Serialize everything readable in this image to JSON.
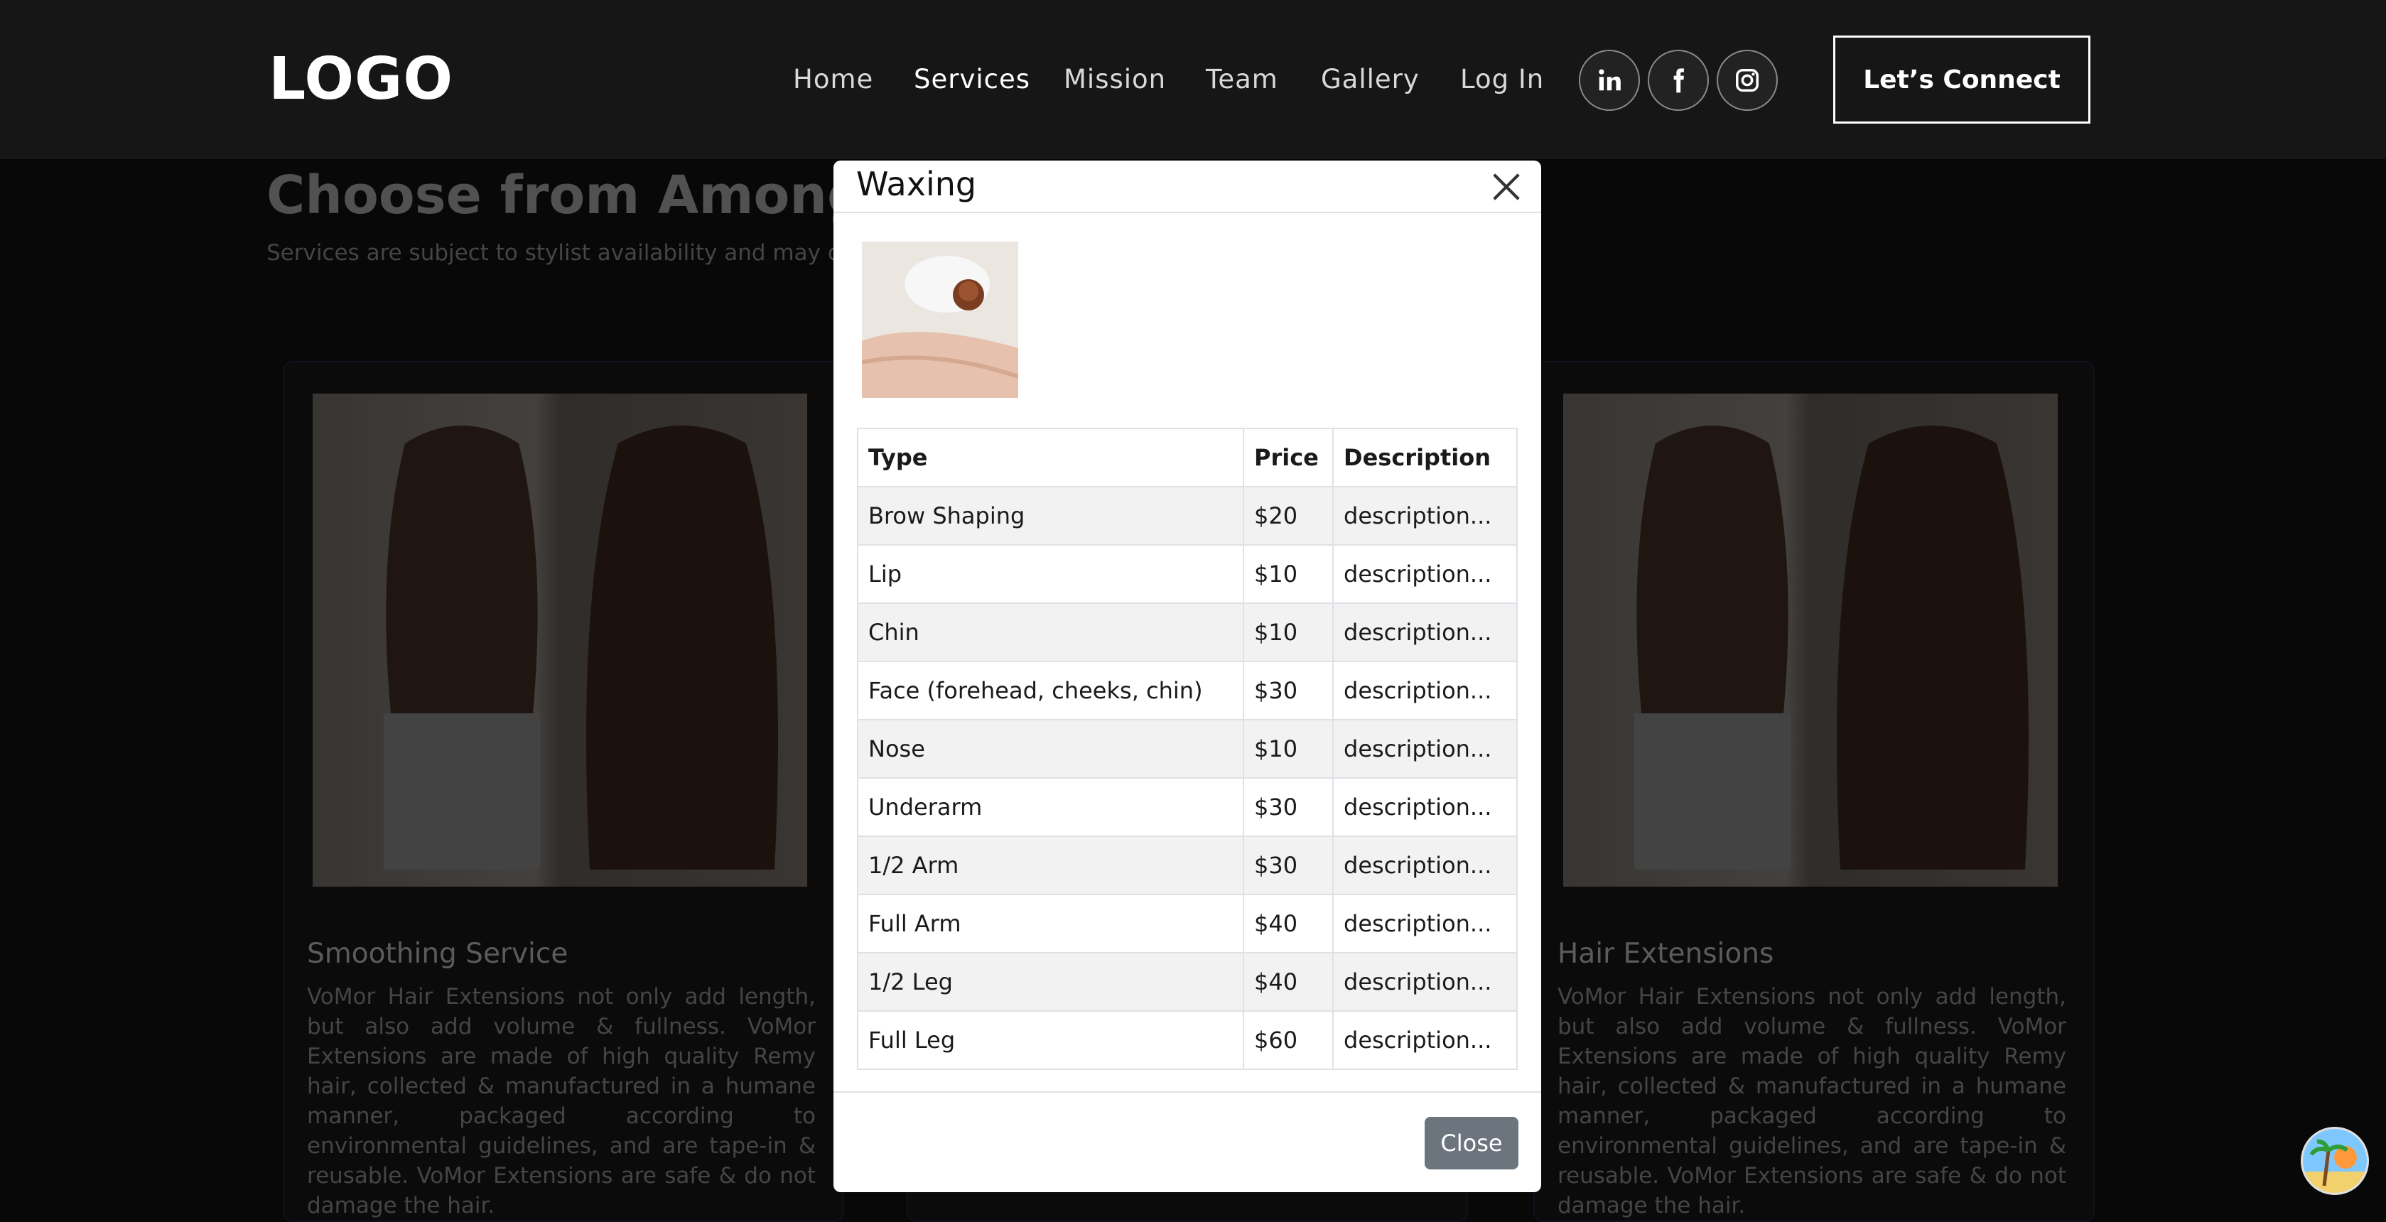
{
  "header": {
    "logo": "LOGO",
    "nav": [
      {
        "label": "Home",
        "active": false
      },
      {
        "label": "Services",
        "active": true
      },
      {
        "label": "Mission",
        "active": false
      },
      {
        "label": "Team",
        "active": false
      },
      {
        "label": "Gallery",
        "active": false
      },
      {
        "label": "Log In",
        "active": false
      }
    ],
    "social": [
      "linkedin-icon",
      "facebook-icon",
      "instagram-icon"
    ],
    "cta_label": "Let’s Connect"
  },
  "page": {
    "title": "Choose from Among Ou",
    "subtitle": "Services are subject to stylist availability and may char"
  },
  "cards": [
    {
      "title": "Smoothing Service",
      "text": "VoMor Hair Extensions not only add length, but also add volume & fullness. VoMor Extensions are made of high quality Remy hair, collected & manufactured in a humane manner, packaged according to environmental guidelines, and are tape-in & reusable. VoMor Extensions are safe & do not damage the hair."
    },
    {
      "title": "Hair Extensions",
      "text": "VoMor Hair Extensions not only add length, but also add volume & fullness. VoMor Extensions are made of high quality Remy hair, collected & manufactured in a humane manner, packaged according to environmental guidelines, and are tape-in & reusable. VoMor Extensions are safe & do not damage the hair."
    }
  ],
  "modal": {
    "title": "Waxing",
    "columns": [
      "Type",
      "Price",
      "Description"
    ],
    "rows": [
      [
        "Brow Shaping",
        "$20",
        "description..."
      ],
      [
        "Lip",
        "$10",
        "description..."
      ],
      [
        "Chin",
        "$10",
        "description..."
      ],
      [
        "Face (forehead, cheeks, chin)",
        "$30",
        "description..."
      ],
      [
        "Nose",
        "$10",
        "description..."
      ],
      [
        "Underarm",
        "$30",
        "description..."
      ],
      [
        "1/2 Arm",
        "$30",
        "description..."
      ],
      [
        "Full Arm",
        "$40",
        "description..."
      ],
      [
        "1/2 Leg",
        "$40",
        "description..."
      ],
      [
        "Full Leg",
        "$60",
        "description..."
      ]
    ],
    "close_label": "Close"
  },
  "colors": {
    "header_bg": "#161616",
    "page_bg": "#0b0b0b",
    "close_button": "#6c757d"
  }
}
